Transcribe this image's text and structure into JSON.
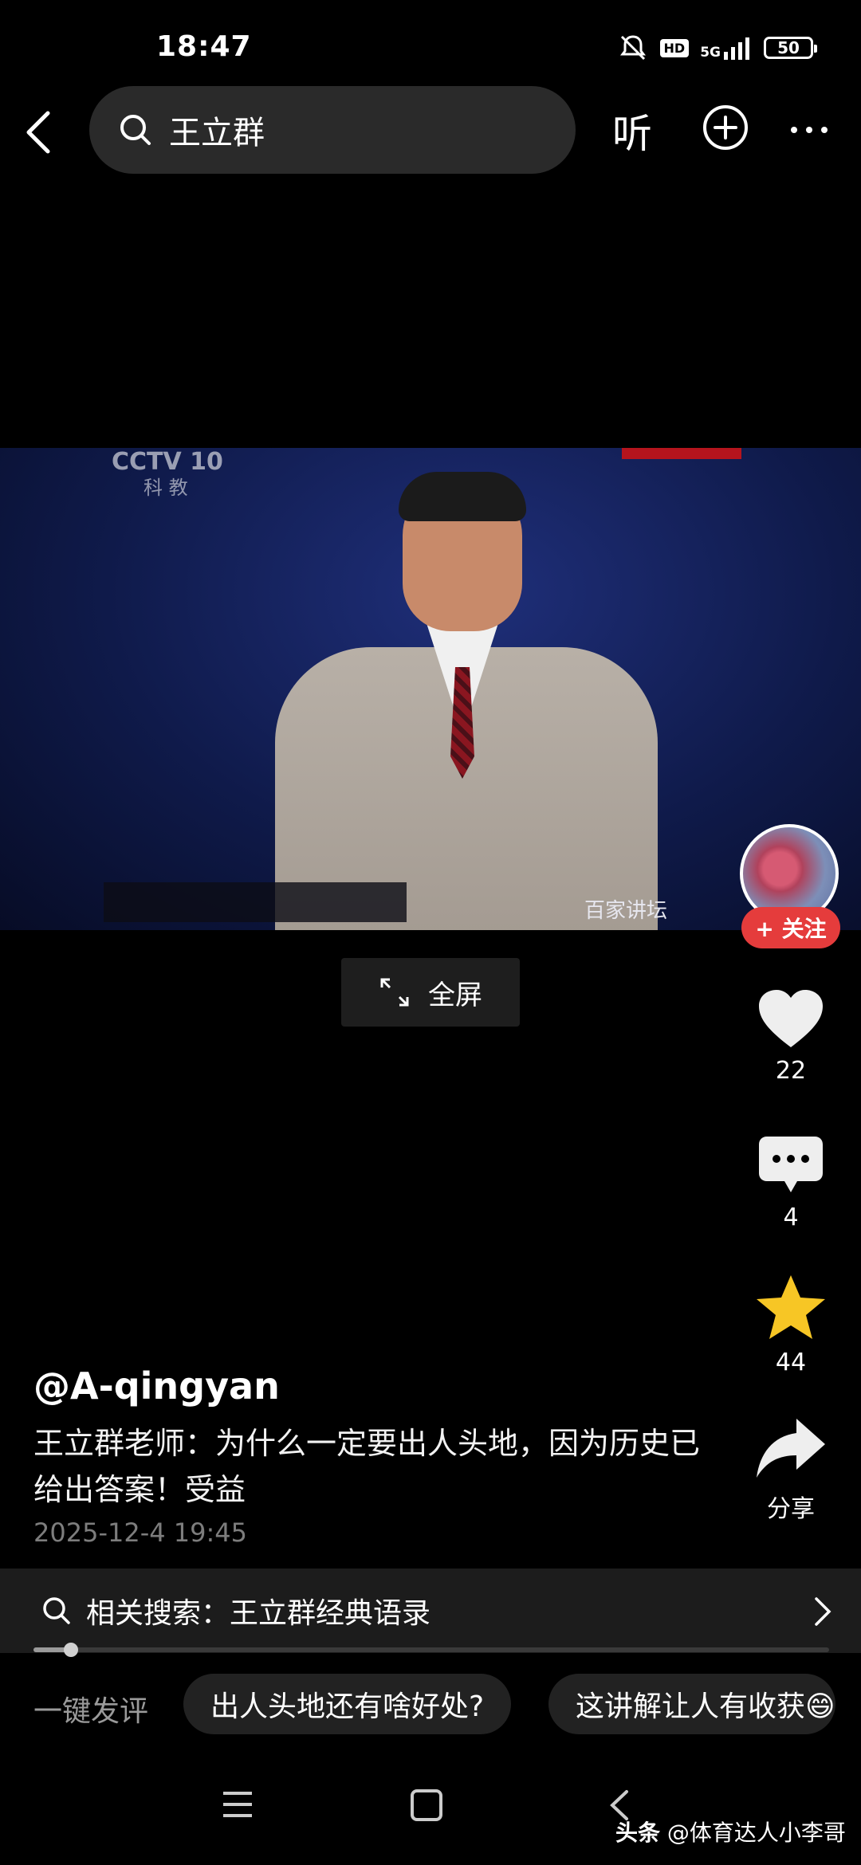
{
  "status_bar": {
    "time": "18:47",
    "hd": "HD",
    "network": "5G",
    "battery": "50"
  },
  "header": {
    "search_value": "王立群",
    "listen_label": "听"
  },
  "video": {
    "channel_mark": "CCTV 10",
    "channel_sub": "科 教",
    "show_logo": "百家讲坛"
  },
  "player": {
    "fullscreen_label": "全屏"
  },
  "rail": {
    "follow_label": "+ 关注",
    "like_count": "22",
    "comment_count": "4",
    "favorite_count": "44",
    "share_label": "分享"
  },
  "post": {
    "author": "@A-qingyan",
    "caption": "王立群老师：为什么一定要出人头地，因为历史已给出答案！受益",
    "date": "2025-12-4 19:45"
  },
  "related_search": {
    "text": "相关搜索：王立群经典语录"
  },
  "quick_comments": {
    "label": "一键发评",
    "chips": [
      "出人头地还有啥好处?",
      "这讲解让人有收获😄"
    ]
  },
  "watermark": {
    "brand": "头条",
    "handle": "@体育达人小李哥"
  },
  "colors": {
    "follow": "#e53c3c",
    "star": "#f7c625",
    "background": "#000000"
  }
}
